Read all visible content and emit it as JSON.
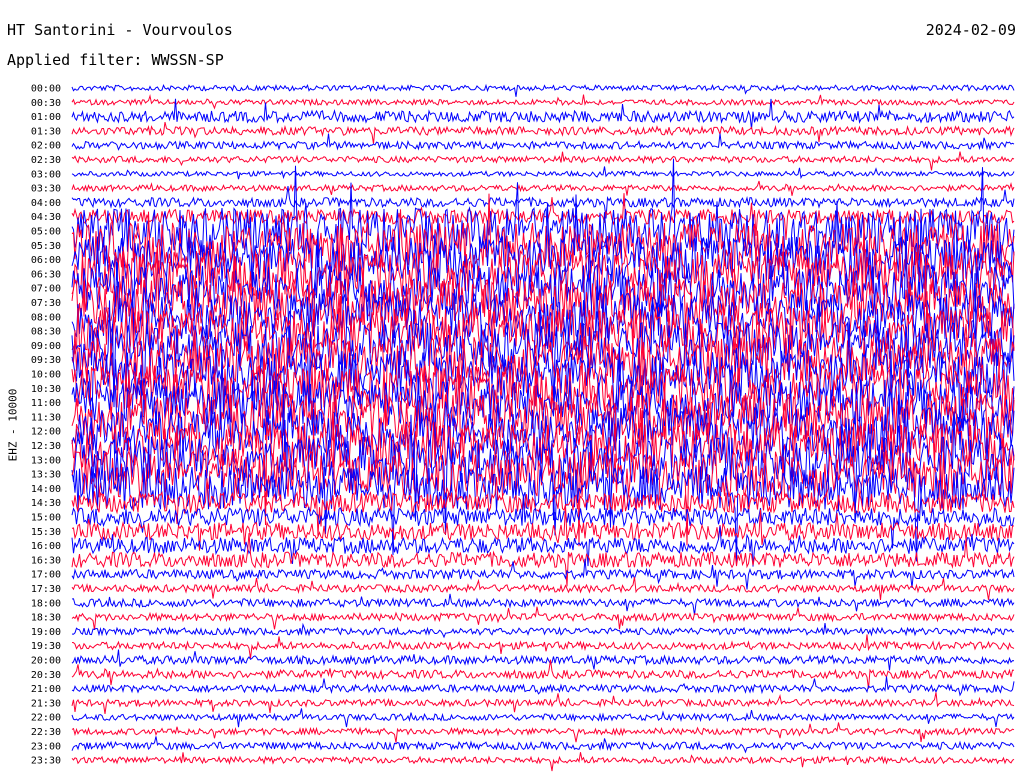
{
  "header": {
    "title": "HT Santorini - Vourvoulos",
    "date": "2024-02-09",
    "filter": "Applied filter: WWSSN-SP"
  },
  "chart_data": {
    "type": "line",
    "title": "HT Santorini - Vourvoulos",
    "subtitle": "Applied filter: WWSSN-SP",
    "ylabel": "EHZ - 10000",
    "time_labels": [
      "00:00",
      "00:30",
      "01:00",
      "01:30",
      "02:00",
      "02:30",
      "03:00",
      "03:30",
      "04:00",
      "04:30",
      "05:00",
      "05:30",
      "06:00",
      "06:30",
      "07:00",
      "07:30",
      "08:00",
      "08:30",
      "09:00",
      "09:30",
      "10:00",
      "10:30",
      "11:00",
      "11:30",
      "12:00",
      "12:30",
      "13:00",
      "13:30",
      "14:00",
      "14:30",
      "15:00",
      "15:30",
      "16:00",
      "16:30",
      "17:00",
      "17:30",
      "18:00",
      "18:30",
      "19:00",
      "19:30",
      "20:00",
      "20:30",
      "21:00",
      "21:30",
      "22:00",
      "22:30",
      "23:00",
      "23:30"
    ],
    "trace_colors": [
      "#0000ff",
      "#ff0033"
    ],
    "activity_level": [
      0.15,
      0.15,
      0.45,
      0.3,
      0.25,
      0.2,
      0.12,
      0.18,
      0.35,
      0.6,
      1.0,
      1.0,
      1.0,
      1.0,
      1.0,
      1.0,
      1.0,
      1.0,
      1.0,
      1.0,
      1.0,
      1.0,
      1.0,
      1.0,
      1.0,
      1.0,
      1.0,
      1.0,
      0.95,
      0.9,
      0.8,
      0.75,
      0.7,
      0.65,
      0.35,
      0.25,
      0.28,
      0.25,
      0.22,
      0.25,
      0.3,
      0.3,
      0.25,
      0.22,
      0.2,
      0.2,
      0.25,
      0.2
    ]
  }
}
